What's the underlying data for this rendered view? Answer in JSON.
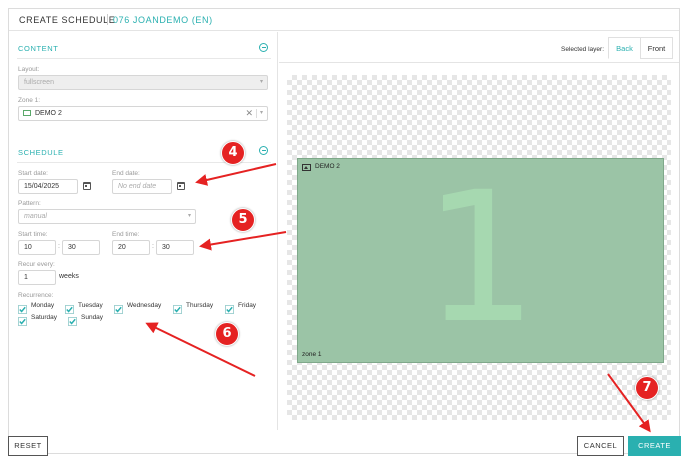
{
  "header": {
    "title": "CREATE SCHEDULE",
    "subtitle": "076 JOANDEMO (EN)"
  },
  "content": {
    "section_title": "CONTENT",
    "layout_label": "Layout:",
    "layout_value": "fullscreen",
    "zone_label": "Zone 1:",
    "zone_value": "DEMO 2"
  },
  "schedule": {
    "section_title": "SCHEDULE",
    "start_date_label": "Start date:",
    "start_date_value": "15/04/2025",
    "end_date_label": "End date:",
    "end_date_placeholder": "No end date",
    "pattern_label": "Pattern:",
    "pattern_value": "manual",
    "start_time_label": "Start time:",
    "start_hour": "10",
    "start_minute": "30",
    "end_time_label": "End time:",
    "end_hour": "20",
    "end_minute": "30",
    "time_separator": ":",
    "recur_label": "Recur every:",
    "recur_value": "1",
    "recur_unit": "weeks",
    "recurrence_label": "Recurrence:",
    "days": [
      {
        "label": "Monday",
        "checked": true
      },
      {
        "label": "Tuesday",
        "checked": true
      },
      {
        "label": "Wednesday",
        "checked": true
      },
      {
        "label": "Thursday",
        "checked": true
      },
      {
        "label": "Friday",
        "checked": true
      },
      {
        "label": "Saturday",
        "checked": true
      },
      {
        "label": "Sunday",
        "checked": true
      }
    ]
  },
  "preview": {
    "selected_layer_label": "Selected layer:",
    "tabs": [
      {
        "label": "Back",
        "active": true
      },
      {
        "label": "Front",
        "active": false
      }
    ],
    "zone_number": "1",
    "zone_media": "DEMO 2",
    "zone_name": "zone 1"
  },
  "footer": {
    "reset_label": "RESET",
    "cancel_label": "CANCEL",
    "create_label": "CREATE"
  },
  "annotations": {
    "step_4": "4",
    "step_5": "5",
    "step_6": "6",
    "step_7": "7"
  },
  "colors": {
    "accent": "#2ab0b0",
    "zone_fill": "#9bc4a6",
    "annotation_red": "#e52222"
  }
}
